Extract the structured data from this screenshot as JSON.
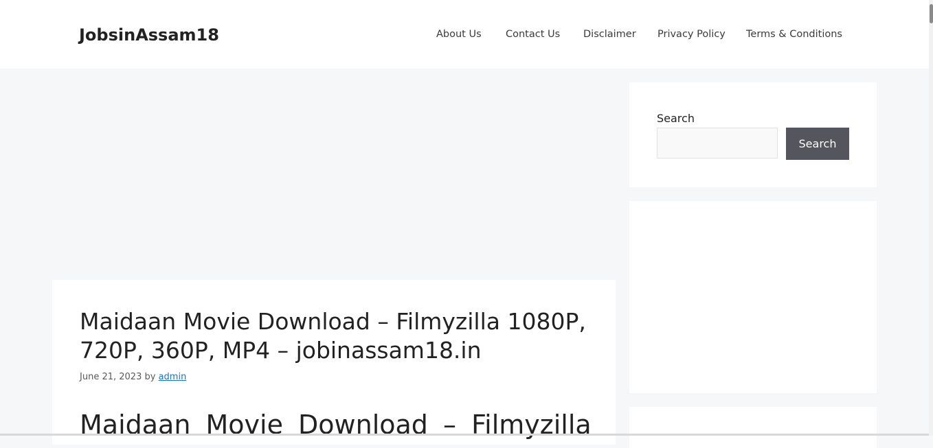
{
  "header": {
    "site_title": "JobsinAssam18",
    "nav": [
      {
        "label": "About Us"
      },
      {
        "label": "Contact Us"
      },
      {
        "label": "Disclaimer"
      },
      {
        "label": "Privacy Policy"
      },
      {
        "label": "Terms & Conditions"
      }
    ]
  },
  "article": {
    "title": "Maidaan Movie Download – Filmyzilla 1080P, 720P, 360P, MP4 – jobinassam18.in",
    "date": "June 21, 2023",
    "by": "by",
    "author": "admin",
    "content_heading": "Maidaan Movie Download – Filmyzilla"
  },
  "sidebar": {
    "search": {
      "label": "Search",
      "input_value": "",
      "button_label": "Search"
    }
  },
  "colors": {
    "header_bg": "#ffffff",
    "page_bg": "#f6f7f8",
    "button_bg": "#55555e",
    "link": "#1e73be"
  }
}
